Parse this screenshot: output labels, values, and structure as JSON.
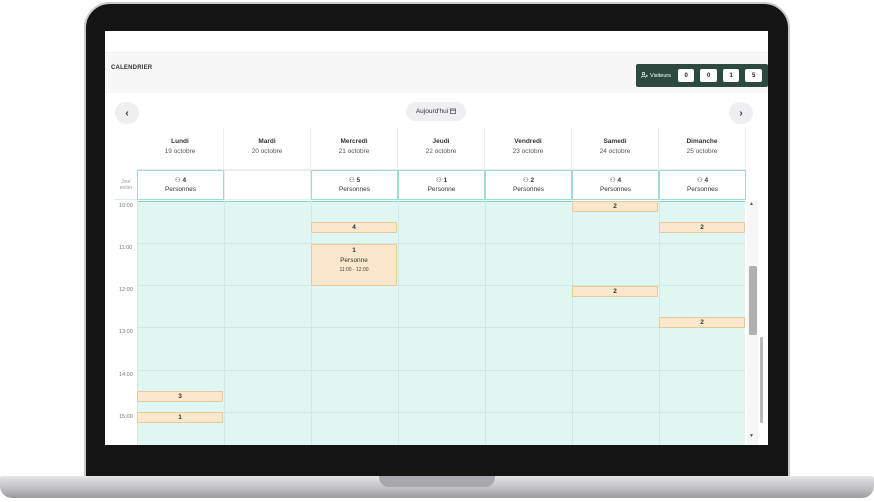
{
  "header": {
    "title": "CALENDRIER",
    "visitors_label": "Visiteurs",
    "visitor_counts": [
      "0",
      "0",
      "1",
      "5"
    ]
  },
  "nav": {
    "prev": "‹",
    "next": "›",
    "today": "Aujourd'hui",
    "today_icon": "calendar-icon"
  },
  "days": [
    {
      "name": "Lundi",
      "date": "19 octobre"
    },
    {
      "name": "Mardi",
      "date": "20 octobre"
    },
    {
      "name": "Mercredi",
      "date": "21 octobre"
    },
    {
      "name": "Jeudi",
      "date": "22 octobre"
    },
    {
      "name": "Vendredi",
      "date": "23 octobre"
    },
    {
      "name": "Samedi",
      "date": "24 octobre"
    },
    {
      "name": "Dimanche",
      "date": "25 octobre"
    }
  ],
  "allday": {
    "label": "Jour entier",
    "cells": [
      {
        "count": "4",
        "text": "Personnes"
      },
      null,
      {
        "count": "5",
        "text": "Personnes"
      },
      {
        "count": "1",
        "text": "Personne"
      },
      {
        "count": "2",
        "text": "Personnes"
      },
      {
        "count": "4",
        "text": "Personnes"
      },
      {
        "count": "4",
        "text": "Personnes"
      }
    ]
  },
  "hours": [
    "10:00",
    "11:00",
    "12:00",
    "13:00",
    "14:00",
    "15:00"
  ],
  "events": [
    {
      "day": 5,
      "label": "2"
    },
    {
      "day": 2,
      "label": "4"
    },
    {
      "day": 6,
      "label": "2"
    },
    {
      "day": 5,
      "label": "2"
    },
    {
      "day": 6,
      "label": "2"
    },
    {
      "day": 0,
      "label": "3"
    },
    {
      "day": 0,
      "label": "1"
    }
  ],
  "detail_event": {
    "day": 2,
    "count": "1",
    "text": "Personne",
    "time": "11:00 - 12:00"
  },
  "colors": {
    "accent": "#2d4a3f",
    "grid": "#e0f6f2",
    "event": "#fbe7cb"
  }
}
